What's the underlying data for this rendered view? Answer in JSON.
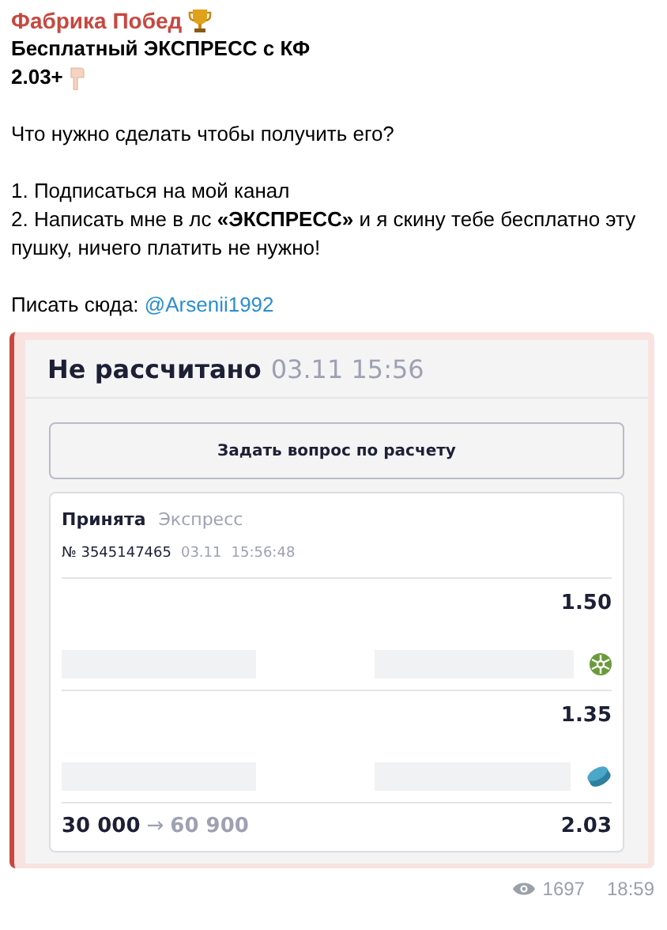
{
  "channel": {
    "name": "Фабрика Побед"
  },
  "post": {
    "title": "Бесплатный ЭКСПРЕСС с КФ",
    "odds_line": "2.03+",
    "question": "Что нужно сделать чтобы получить его?",
    "steps": [
      "1. Подписаться на мой канал",
      "2. Написать мне в лс **«ЭКСПРЕСС»** и я скину тебе бесплатно эту пушку, ничего платить не нужно!"
    ],
    "contact_label": "Писать сюда:",
    "contact_link": "@Arsenii1992"
  },
  "bet_slip": {
    "status": "Не рассчитано",
    "status_time": "03.11 15:56",
    "ask_button": "Задать вопрос по расчету",
    "bet_state": "Принята",
    "bet_type": "Экспресс",
    "bet_number": "№ 3545147465",
    "bet_date": "03.11",
    "bet_time": "15:56:48",
    "events": [
      {
        "odds": "1.50",
        "kind": "soccer"
      },
      {
        "odds": "1.35",
        "kind": "hockey"
      }
    ],
    "stake": "30 000",
    "arrow": "→",
    "payout": "60 900",
    "total_odds": "2.03"
  },
  "footer": {
    "views": "1697",
    "time": "18:59"
  }
}
